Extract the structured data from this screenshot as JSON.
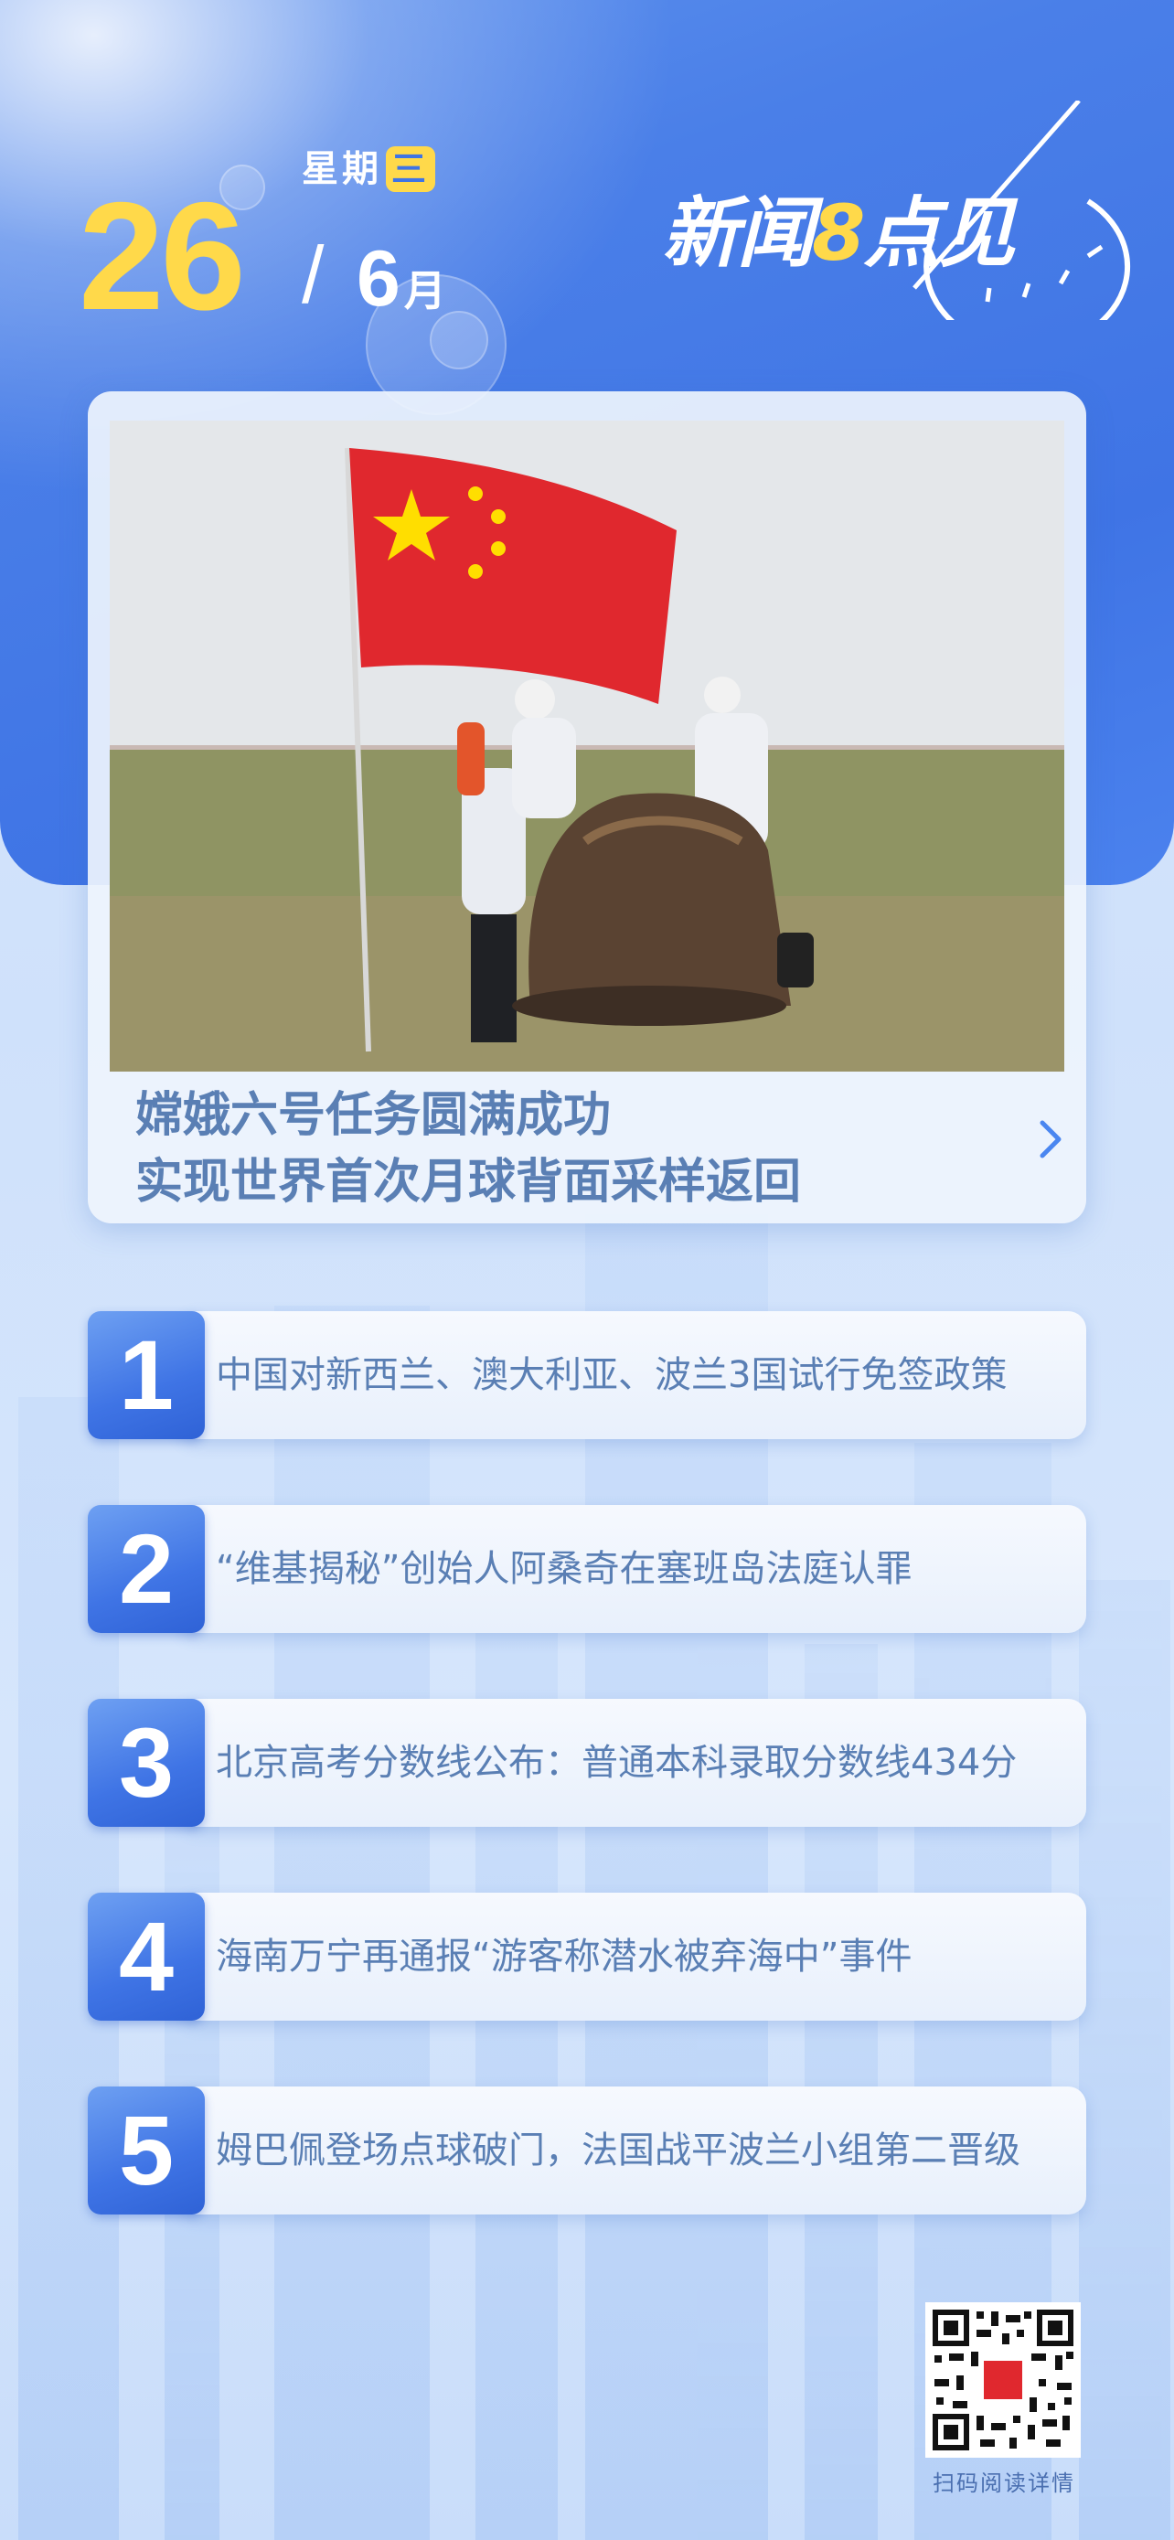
{
  "date": {
    "weekday_prefix": "星期",
    "weekday_char": "三",
    "day": "26",
    "slash": "/",
    "month": "6",
    "month_unit": "月"
  },
  "brand": {
    "name_part1": "新闻",
    "name_number": "8",
    "name_part2": "点见"
  },
  "headline": {
    "line1": "嫦娥六号任务圆满成功",
    "line2": "实现世界首次月球背面采样返回",
    "photo_icon": "chinese-flag-and-return-capsule"
  },
  "news": [
    {
      "num": "1",
      "text": "中国对新西兰、澳大利亚、波兰3国试行免签政策"
    },
    {
      "num": "2",
      "text": "“维基揭秘”创始人阿桑奇在塞班岛法庭认罪"
    },
    {
      "num": "3",
      "text": "北京高考分数线公布：普通本科录取分数线434分"
    },
    {
      "num": "4",
      "text": "海南万宁再通报“游客称潜水被弃海中”事件"
    },
    {
      "num": "5",
      "text": "姆巴佩登场点球破门，法国战平波兰小组第二晋级"
    }
  ],
  "qr": {
    "caption": "扫码阅读详情",
    "icon": "qr-code"
  },
  "colors": {
    "accent_yellow": "#ffd94a",
    "primary_blue": "#3f74e5",
    "text_blue": "#5a7fb4"
  }
}
